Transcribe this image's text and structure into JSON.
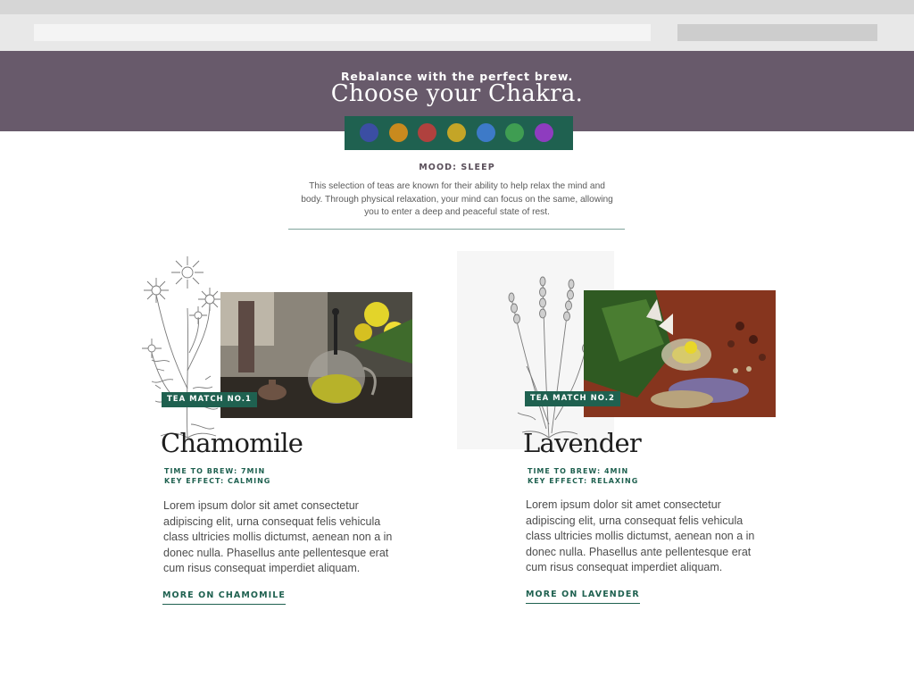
{
  "hero": {
    "kicker": "Rebalance with the perfect brew.",
    "title": "Choose your Chakra."
  },
  "chakras": [
    {
      "name": "chakra-blue",
      "color": "#3b4ea3"
    },
    {
      "name": "chakra-orange",
      "color": "#c98a1e"
    },
    {
      "name": "chakra-red",
      "color": "#b0413e"
    },
    {
      "name": "chakra-yellow",
      "color": "#c4a527"
    },
    {
      "name": "chakra-light-blue",
      "color": "#3d7ac8"
    },
    {
      "name": "chakra-green",
      "color": "#3f9d52"
    },
    {
      "name": "chakra-purple",
      "color": "#8e3cbf"
    }
  ],
  "mood": {
    "label": "MOOD: SLEEP",
    "description": "This selection of teas are known for their ability to help relax the mind and body. Through physical relaxation, your mind can focus on the same, allowing you to enter a deep and peaceful state of rest."
  },
  "teas": [
    {
      "badge": "TEA MATCH NO.1",
      "name": "Chamomile",
      "brew_time": "TIME TO BREW: 7MIN",
      "effect": "KEY EFFECT: CALMING",
      "body": "Lorem ipsum dolor sit amet consectetur adipiscing elit, urna consequat felis vehicula class ultricies mollis dictumst, aenean non a in donec nulla. Phasellus ante pellentesque erat cum risus consequat imperdiet aliquam.",
      "link": "MORE ON CHAMOMILE"
    },
    {
      "badge": "TEA MATCH NO.2",
      "name": "Lavender",
      "brew_time": "TIME TO BREW: 4MIN",
      "effect": "KEY EFFECT: RELAXING",
      "body": "Lorem ipsum dolor sit amet consectetur adipiscing elit, urna consequat felis vehicula class ultricies mollis dictumst, aenean non a in donec nulla. Phasellus ante pellentesque erat cum risus consequat imperdiet aliquam.",
      "link": "MORE ON LAVENDER"
    }
  ]
}
